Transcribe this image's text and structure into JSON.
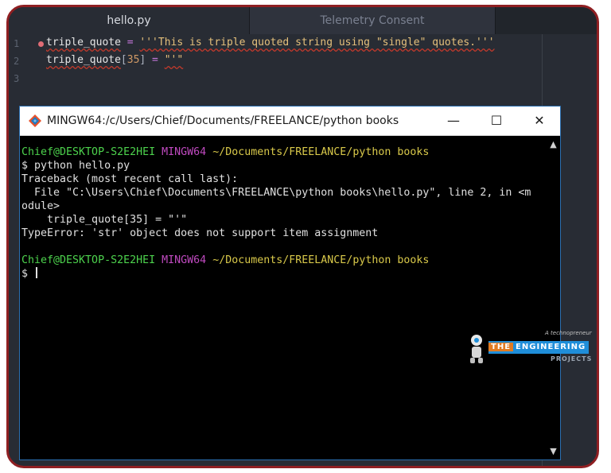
{
  "editor": {
    "tabs": [
      {
        "label": "hello.py",
        "active": true
      },
      {
        "label": "Telemetry Consent",
        "active": false
      }
    ],
    "gutter": [
      "1",
      "2",
      "3"
    ],
    "line1": {
      "ident": "triple_quote",
      "op": " = ",
      "str": "'''This is triple quoted string using \"single\" quotes.'''"
    },
    "line2": {
      "ident": "triple_quote",
      "bracket_open": "[",
      "num": "35",
      "bracket_close": "]",
      "op": " = ",
      "str": "\"'\""
    }
  },
  "terminal": {
    "title": "MINGW64:/c/Users/Chief/Documents/FREELANCE/python books",
    "buttons": {
      "minimize": "—",
      "maximize": "☐",
      "close": "✕"
    },
    "prompt": {
      "user": "Chief@DESKTOP-S2E2HEI",
      "env": "MINGW64",
      "path": "~/Documents/FREELANCE/python books"
    },
    "lines": [
      "$ python hello.py",
      "Traceback (most recent call last):",
      "  File \"C:\\Users\\Chief\\Documents\\FREELANCE\\python books\\hello.py\", line 2, in <m",
      "odule>",
      "    triple_quote[35] = \"'\"",
      "TypeError: 'str' object does not support item assignment"
    ],
    "prompt2": {
      "user": "Chief@DESKTOP-S2E2HEI",
      "env": "MINGW64",
      "path": "~/Documents/FREELANCE/python books"
    },
    "cursor_line": "$ ",
    "scroll_up": "▲",
    "scroll_down": "▼"
  },
  "watermark": {
    "tag": "A technopreneur",
    "the": "THE",
    "main": "ENGINEERING",
    "sub": "PROJECTS"
  },
  "colors": {
    "frame_border": "#8f1f22",
    "prompt_user": "#4dd34d",
    "prompt_env": "#c04ac0",
    "prompt_path": "#d9c94a"
  }
}
